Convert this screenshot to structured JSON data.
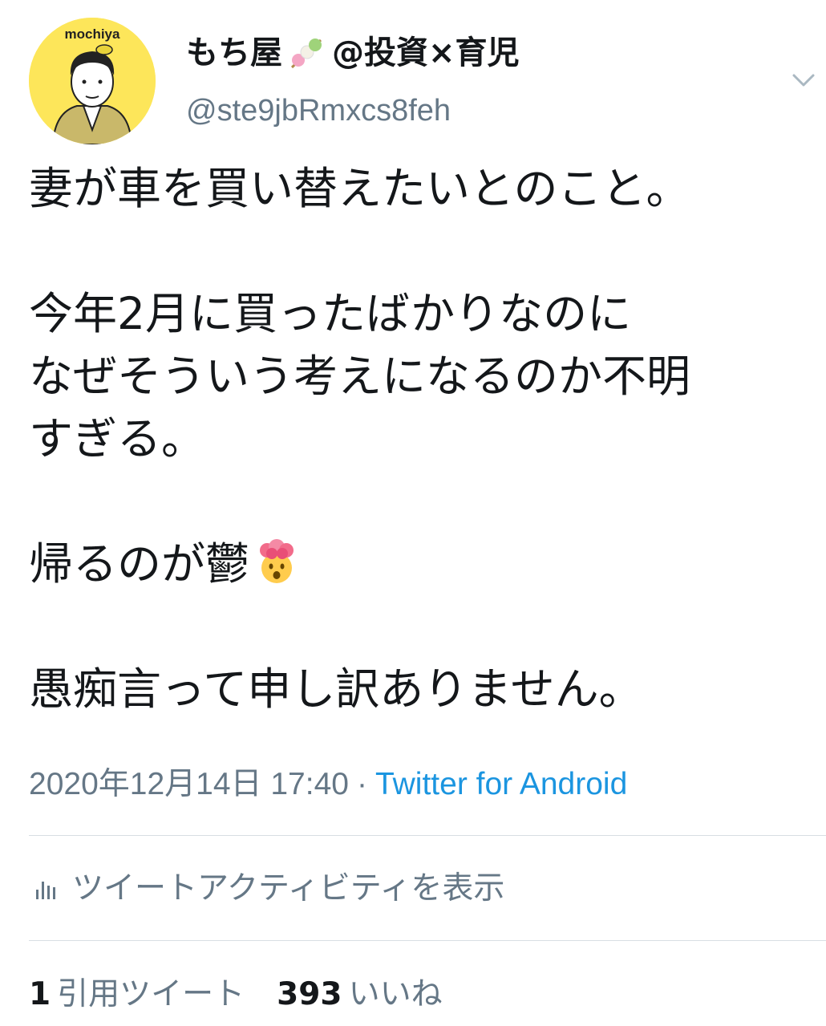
{
  "author": {
    "display_name": "もち屋",
    "display_suffix": "@投資×育児",
    "handle": "@ste9jbRmxcs8feh",
    "avatar_text": "mochiya"
  },
  "tweet": {
    "lines": [
      "妻が車を買い替えたいとのこと。",
      "",
      "今年2月に買ったばかりなのに",
      "なぜそういう考えになるのか不明",
      "すぎる。",
      "",
      "帰るのが鬱",
      "",
      "愚痴言って申し訳ありません。"
    ],
    "emoji": "exploding-head-emoji"
  },
  "meta": {
    "timestamp": "2020年12月14日 17:40",
    "separator": "·",
    "source": "Twitter for Android"
  },
  "activity": {
    "label": "ツイートアクティビティを表示"
  },
  "stats": {
    "quote_count": "1",
    "quote_label": "引用ツイート",
    "like_count": "393",
    "like_label": "いいね"
  },
  "colors": {
    "text": "#14171a",
    "secondary": "#657786",
    "link": "#1b95e0",
    "avatar_bg": "#fde65a",
    "divider": "#d8dee3"
  }
}
